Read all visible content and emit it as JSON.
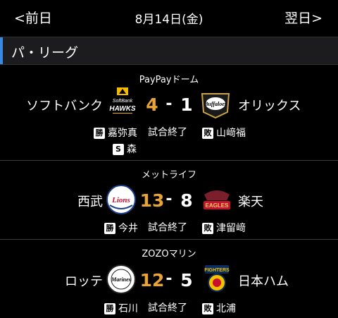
{
  "header": {
    "prev_label": "<前日",
    "date_label": "8月14日(金)",
    "next_label": "翌日>"
  },
  "league": {
    "name": "パ・リーグ",
    "accent_color": "#3a88e0"
  },
  "colors": {
    "win_score": "#e8a33a",
    "lose_score": "#ffffff"
  },
  "games": [
    {
      "venue": "PayPayドーム",
      "home_team": "ソフトバンク",
      "away_team": "オリックス",
      "home_logo": "hawks-logo-icon",
      "away_logo": "buffaloes-logo-icon",
      "home_logo_text": "SoftBank HAWKS",
      "away_logo_text": "Buffaloes",
      "home_score": "4",
      "away_score": "1",
      "dash": "-",
      "status": "試合終了",
      "win_badge": "勝",
      "win_pitcher": "嘉弥真",
      "lose_badge": "敗",
      "lose_pitcher": "山﨑福",
      "save_badge": "S",
      "save_pitcher": "森"
    },
    {
      "venue": "メットライフ",
      "home_team": "西武",
      "away_team": "楽天",
      "home_logo": "lions-logo-icon",
      "away_logo": "eagles-logo-icon",
      "home_logo_text": "Lions",
      "away_logo_text": "EAGLES",
      "home_score": "13",
      "away_score": "8",
      "dash": "-",
      "status": "試合終了",
      "win_badge": "勝",
      "win_pitcher": "今井",
      "lose_badge": "敗",
      "lose_pitcher": "津留﨑"
    },
    {
      "venue": "ZOZOマリン",
      "home_team": "ロッテ",
      "away_team": "日本ハム",
      "home_logo": "marines-logo-icon",
      "away_logo": "fighters-logo-icon",
      "home_logo_text": "Marines",
      "away_logo_text": "FIGHTERS",
      "home_score": "12",
      "away_score": "5",
      "dash": "-",
      "status": "試合終了",
      "win_badge": "勝",
      "win_pitcher": "石川",
      "lose_badge": "敗",
      "lose_pitcher": "北浦"
    }
  ]
}
